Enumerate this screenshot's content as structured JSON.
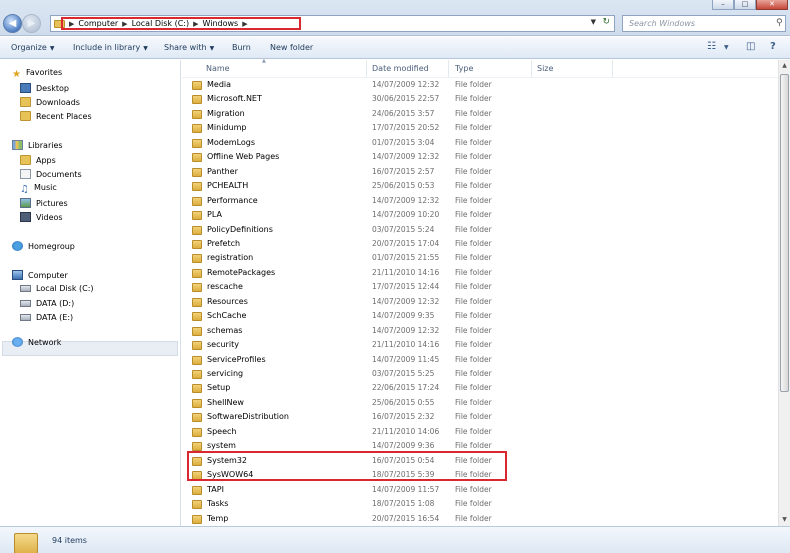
{
  "window": {
    "controls": {
      "minimize": "–",
      "maximize": "□",
      "close": "✕"
    }
  },
  "address": {
    "breadcrumbs": [
      "Computer",
      "Local Disk (C:)",
      "Windows"
    ],
    "search_placeholder": "Search Windows"
  },
  "toolbar": {
    "organize": "Organize",
    "include_in_library": "Include in library",
    "share_with": "Share with",
    "burn": "Burn",
    "new_folder": "New folder"
  },
  "sidebar": {
    "favorites": {
      "label": "Favorites",
      "items": [
        "Desktop",
        "Downloads",
        "Recent Places"
      ]
    },
    "libraries": {
      "label": "Libraries",
      "items": [
        "Apps",
        "Documents",
        "Music",
        "Pictures",
        "Videos"
      ]
    },
    "homegroup": {
      "label": "Homegroup"
    },
    "computer": {
      "label": "Computer",
      "items": [
        "Local Disk (C:)",
        "DATA (D:)",
        "DATA (E:)"
      ]
    },
    "network": {
      "label": "Network"
    }
  },
  "columns": {
    "name": "Name",
    "date_modified": "Date modified",
    "type": "Type",
    "size": "Size"
  },
  "files": [
    {
      "name": "Media",
      "date": "14/07/2009 12:32",
      "type": "File folder"
    },
    {
      "name": "Microsoft.NET",
      "date": "30/06/2015 22:57",
      "type": "File folder"
    },
    {
      "name": "Migration",
      "date": "24/06/2015 3:57",
      "type": "File folder"
    },
    {
      "name": "Minidump",
      "date": "17/07/2015 20:52",
      "type": "File folder"
    },
    {
      "name": "ModemLogs",
      "date": "01/07/2015 3:04",
      "type": "File folder"
    },
    {
      "name": "Offline Web Pages",
      "date": "14/07/2009 12:32",
      "type": "File folder"
    },
    {
      "name": "Panther",
      "date": "16/07/2015 2:57",
      "type": "File folder"
    },
    {
      "name": "PCHEALTH",
      "date": "25/06/2015 0:53",
      "type": "File folder"
    },
    {
      "name": "Performance",
      "date": "14/07/2009 12:32",
      "type": "File folder"
    },
    {
      "name": "PLA",
      "date": "14/07/2009 10:20",
      "type": "File folder"
    },
    {
      "name": "PolicyDefinitions",
      "date": "03/07/2015 5:24",
      "type": "File folder"
    },
    {
      "name": "Prefetch",
      "date": "20/07/2015 17:04",
      "type": "File folder"
    },
    {
      "name": "registration",
      "date": "01/07/2015 21:55",
      "type": "File folder"
    },
    {
      "name": "RemotePackages",
      "date": "21/11/2010 14:16",
      "type": "File folder"
    },
    {
      "name": "rescache",
      "date": "17/07/2015 12:44",
      "type": "File folder"
    },
    {
      "name": "Resources",
      "date": "14/07/2009 12:32",
      "type": "File folder"
    },
    {
      "name": "SchCache",
      "date": "14/07/2009 9:35",
      "type": "File folder"
    },
    {
      "name": "schemas",
      "date": "14/07/2009 12:32",
      "type": "File folder"
    },
    {
      "name": "security",
      "date": "21/11/2010 14:16",
      "type": "File folder"
    },
    {
      "name": "ServiceProfiles",
      "date": "14/07/2009 11:45",
      "type": "File folder"
    },
    {
      "name": "servicing",
      "date": "03/07/2015 5:25",
      "type": "File folder"
    },
    {
      "name": "Setup",
      "date": "22/06/2015 17:24",
      "type": "File folder"
    },
    {
      "name": "ShellNew",
      "date": "25/06/2015 0:55",
      "type": "File folder"
    },
    {
      "name": "SoftwareDistribution",
      "date": "16/07/2015 2:32",
      "type": "File folder"
    },
    {
      "name": "Speech",
      "date": "21/11/2010 14:06",
      "type": "File folder"
    },
    {
      "name": "system",
      "date": "14/07/2009 9:36",
      "type": "File folder"
    },
    {
      "name": "System32",
      "date": "16/07/2015 0:54",
      "type": "File folder"
    },
    {
      "name": "SysWOW64",
      "date": "18/07/2015 5:39",
      "type": "File folder"
    },
    {
      "name": "TAPI",
      "date": "14/07/2009 11:57",
      "type": "File folder"
    },
    {
      "name": "Tasks",
      "date": "18/07/2015 1:08",
      "type": "File folder"
    },
    {
      "name": "Temp",
      "date": "20/07/2015 16:54",
      "type": "File folder"
    }
  ],
  "highlighted_files": [
    "System32",
    "SysWOW64"
  ],
  "status": {
    "item_count": "94 items"
  },
  "colors": {
    "highlight": "#d9282f",
    "folder": "#e7c257"
  }
}
